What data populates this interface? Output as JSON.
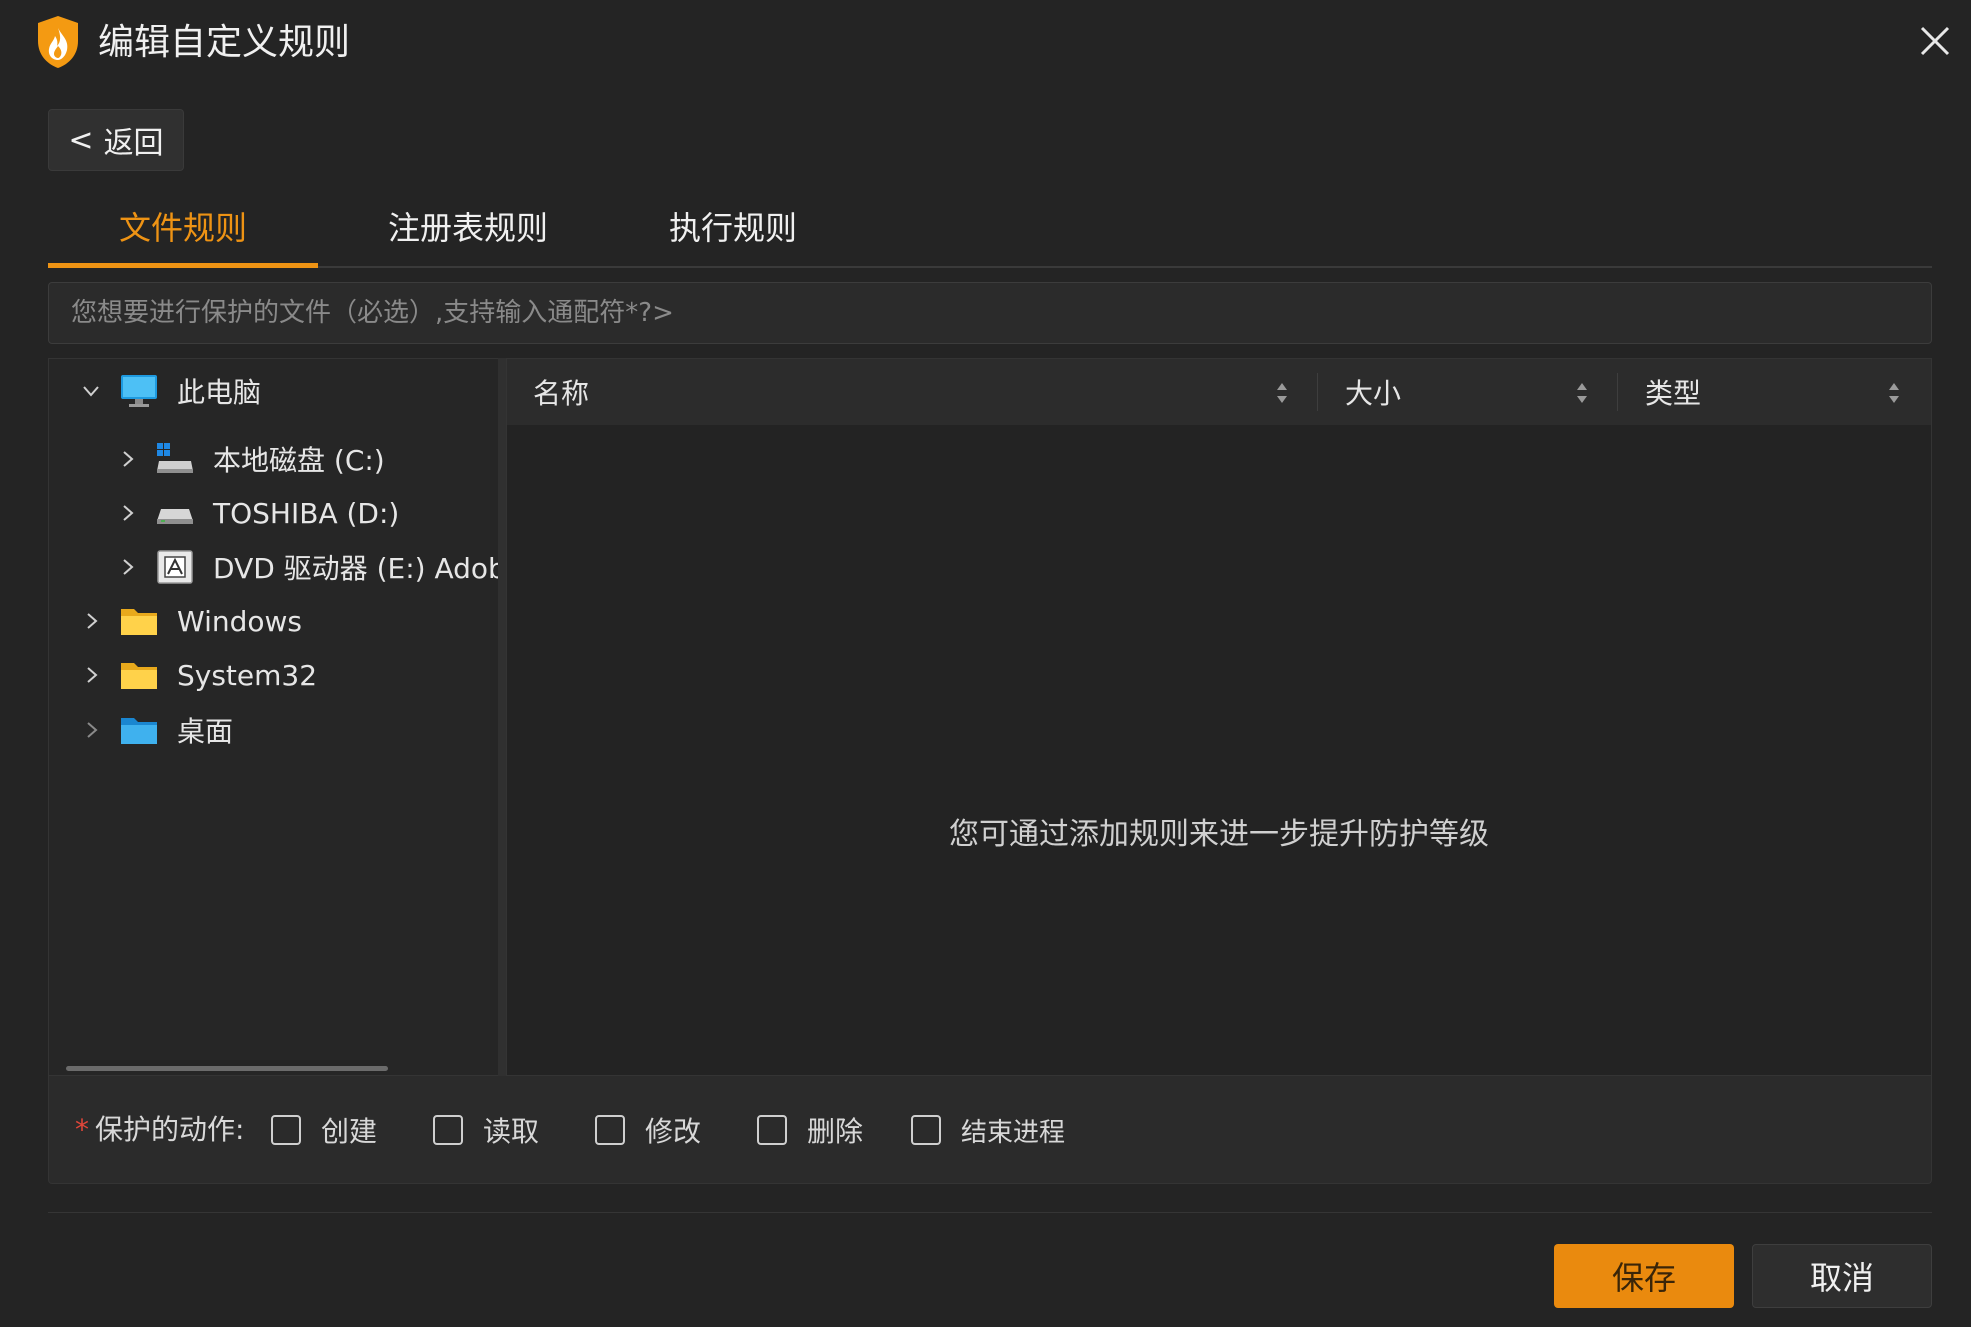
{
  "window": {
    "title": "编辑自定义规则",
    "close_icon": "close-icon",
    "logo_icon": "flame-shield-icon",
    "accent_color": "#ee9314"
  },
  "back_button": {
    "chevron": "<",
    "label": "返回"
  },
  "tabs": [
    {
      "label": "文件规则",
      "active": true
    },
    {
      "label": "注册表规则",
      "active": false
    },
    {
      "label": "执行规则",
      "active": false
    }
  ],
  "path_input": {
    "value": "",
    "placeholder": "您想要进行保护的文件（必选）,支持输入通配符*?>"
  },
  "tree": {
    "items": [
      {
        "label": "此电脑",
        "expanded": true,
        "icon": "computer-icon"
      },
      {
        "label": "本地磁盘 (C:)",
        "expanded": false,
        "icon": "system-drive-icon"
      },
      {
        "label": "TOSHIBA (D:)",
        "expanded": false,
        "icon": "drive-icon"
      },
      {
        "label": "DVD 驱动器 (E:) Adobe",
        "expanded": false,
        "icon": "dvd-drive-icon"
      },
      {
        "label": "Windows",
        "expanded": false,
        "icon": "folder-icon"
      },
      {
        "label": "System32",
        "expanded": false,
        "icon": "folder-icon"
      },
      {
        "label": "桌面",
        "expanded": false,
        "icon": "desktop-folder-icon"
      }
    ]
  },
  "file_list": {
    "columns": [
      {
        "label": "名称",
        "sort_icon": "sort-icon"
      },
      {
        "label": "大小",
        "sort_icon": "sort-icon"
      },
      {
        "label": "类型",
        "sort_icon": "sort-icon"
      }
    ],
    "empty_message": "您可通过添加规则来进一步提升防护等级"
  },
  "actions": {
    "required_mark": "*",
    "label": "保护的动作:",
    "options": [
      {
        "label": "创建",
        "checked": false
      },
      {
        "label": "读取",
        "checked": false
      },
      {
        "label": "修改",
        "checked": false
      },
      {
        "label": "删除",
        "checked": false
      },
      {
        "label": "结束进程",
        "checked": false
      }
    ]
  },
  "footer": {
    "save_label": "保存",
    "cancel_label": "取消"
  }
}
